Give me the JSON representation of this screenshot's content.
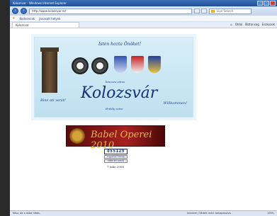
{
  "browser": {
    "title": "Kolozsvar - Windows Internet Explorer",
    "url": "http://www.kolozsvar.ro/",
    "search_placeholder": "Live Search",
    "favorites_label": "Kedvencek",
    "suggested_label": "Javasolt helyek",
    "tab_label": "Kolozsvar",
    "tools": [
      "Oldal",
      "Biztonsag",
      "Eszkozok"
    ],
    "status_text": "Kész, de a oldal hibás.",
    "zone_text": "Internet | Védett mód: bekapcsolva",
    "zoom_text": "100%"
  },
  "page": {
    "motto_top": "Isten hozta Önöket!",
    "small_line": "kincses város",
    "city_name": "Kolozsvár",
    "greet_left": "Bine ati venit!",
    "greet_right": "Willkommen!",
    "sub_bottom": "Erdély szíve",
    "ball_title": "Babel Operei 2010",
    "counter_value": "055129",
    "counter_link_1": "Ingyenes honlap",
    "counter_link_2": "VIEW MY STATS",
    "since_text": "7 iulie 2006"
  },
  "colors": {
    "banner_bg": "#d8eef8",
    "city_text": "#13337a",
    "ball_bg": "#8b1818",
    "ball_text": "#e8b84a"
  }
}
